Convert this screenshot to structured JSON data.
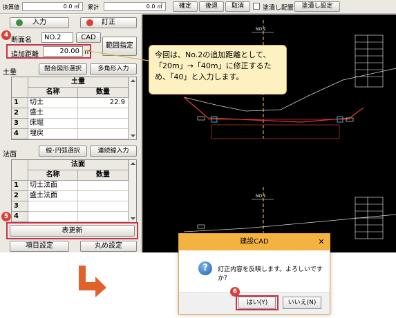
{
  "topbar": {
    "conv_label": "換算値",
    "conv_value": "0.0 ㎡",
    "total_label": "累計",
    "total_value": "0.0 ㎡",
    "confirm": "確定",
    "back": "後退",
    "cancel": "取消",
    "fill_place": "塗潰し配置",
    "fill_settings": "塗潰し設定"
  },
  "panel": {
    "input_btn": "入力",
    "correct_btn": "訂正",
    "section_label": "断面名",
    "section_value": "NO.2",
    "cad_btn": "CAD",
    "range_btn": "範囲指定",
    "distance_label": "追加距離",
    "distance_value": "20.00",
    "distance_unit": "m",
    "earth_label": "土量",
    "closed_select_btn": "閉合図形選択",
    "polygon_btn": "多角形入力",
    "slope_label": "法面",
    "line_select_btn": "線･円弧選択",
    "cont_line_btn": "連続線入力",
    "update_btn": "表更新",
    "item_settings_btn": "項目設定",
    "rounding_btn": "丸め設定"
  },
  "earth_table": {
    "title": "土量",
    "col_name": "名称",
    "col_qty": "数量",
    "rows": [
      {
        "num": "1",
        "name": "切土",
        "qty": "22.9"
      },
      {
        "num": "2",
        "name": "盛土",
        "qty": ""
      },
      {
        "num": "3",
        "name": "床堀",
        "qty": ""
      },
      {
        "num": "4",
        "name": "埋戻",
        "qty": ""
      }
    ]
  },
  "slope_table": {
    "title": "法面",
    "col_name": "名称",
    "col_qty": "数量",
    "rows": [
      {
        "num": "1",
        "name": "切土法面",
        "qty": ""
      },
      {
        "num": "2",
        "name": "盛土法面",
        "qty": ""
      },
      {
        "num": "3",
        "name": "",
        "qty": ""
      },
      {
        "num": "4",
        "name": "",
        "qty": ""
      }
    ]
  },
  "cad": {
    "section_top": "NO.2",
    "section_bottom": "NO.1"
  },
  "callout": {
    "line1": "今回は、No.2の追加距離として、",
    "line2": "「20m」→「40m」に修正するた",
    "line3": "め、「40」と入力します。"
  },
  "badges": {
    "b4": "4",
    "b5": "5",
    "b6": "6"
  },
  "dialog": {
    "title": "建設CAD",
    "close": "✕",
    "icon": "?",
    "message": "訂正内容を反映します。よろしいですか？",
    "yes": "はい(Y)",
    "no": "いいえ(N)"
  },
  "colors": {
    "accent_red": "#d8413a",
    "highlight": "#c8324a",
    "dialog_title": "#f4b241",
    "callout_bg": "#fdf1c2",
    "arrow": "#e0622b"
  }
}
